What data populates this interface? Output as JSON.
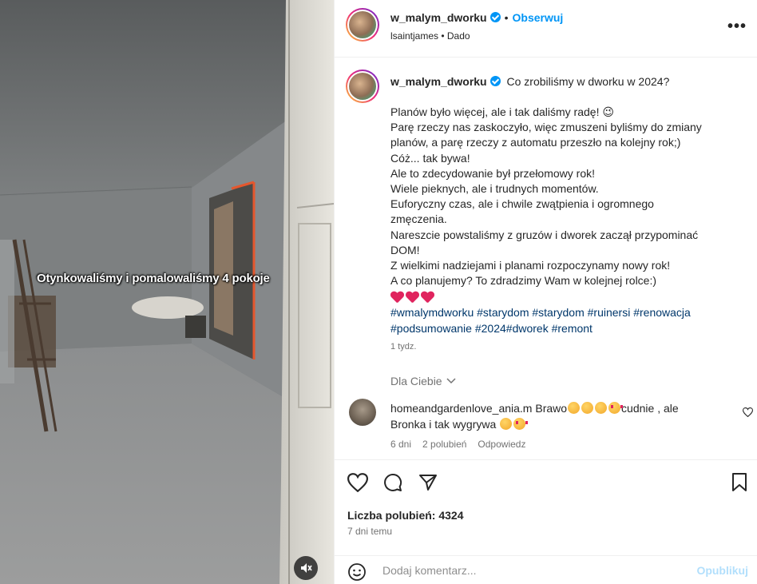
{
  "media": {
    "overlay_text": "Otynkowaliśmy i pomalowaliśmy 4 pokoje",
    "mute_icon": "speaker-muted-icon"
  },
  "header": {
    "username": "w_malym_dworku",
    "separator": "•",
    "follow_label": "Obserwuj",
    "audio_line": "lsaintjames • Dado",
    "more_label": "•••"
  },
  "caption": {
    "username": "w_malym_dworku",
    "title": "Co zrobiliśmy w dworku w 2024?",
    "lines": [
      "Planów było więcej, ale i tak daliśmy radę! 😉",
      "Parę rzeczy nas zaskoczyło, więc zmuszeni byliśmy do zmiany",
      "planów, a parę rzeczy z automatu przeszło na kolejny rok;)",
      "Cóż... tak bywa!",
      "Ale to zdecydowanie był przełomowy rok!",
      "Wiele pieknych, ale i trudnych momentów.",
      "Euforyczny czas, ale i chwile zwątpienia i ogromnego",
      "zmęczenia.",
      "Nareszcie powstaliśmy z gruzów i dworek zaczął przypominać",
      "DOM!",
      "Z wielkimi nadziejami i planami rozpoczynamy nowy rok!",
      "A co planujemy? To zdradzimy Wam w kolejnej rolce:)"
    ],
    "hashtags_line1": "#wmalymdworku #starydom #starydom #ruinersi #renowacja",
    "hashtags_line2": "#podsumowanie #2024#dworek #remont",
    "age": "1 tydz."
  },
  "for_you": "Dla Ciebie",
  "comment": {
    "username": "homeandgardenlove_ania.m",
    "text_a": "Brawo",
    "text_b": "cudnie , ale",
    "text_c": "Bronka i tak wygrywa",
    "age": "6 dni",
    "likes": "2 polubień",
    "reply": "Odpowiedz"
  },
  "actions": {
    "likes": "Liczba polubień: 4324",
    "time": "7 dni temu"
  },
  "add_comment": {
    "placeholder": "Dodaj komentarz...",
    "publish": "Opublikuj"
  },
  "colors": {
    "accent": "#0095f6",
    "hashtag": "#00376b",
    "muted": "#737373",
    "heart": "#e0245e"
  }
}
